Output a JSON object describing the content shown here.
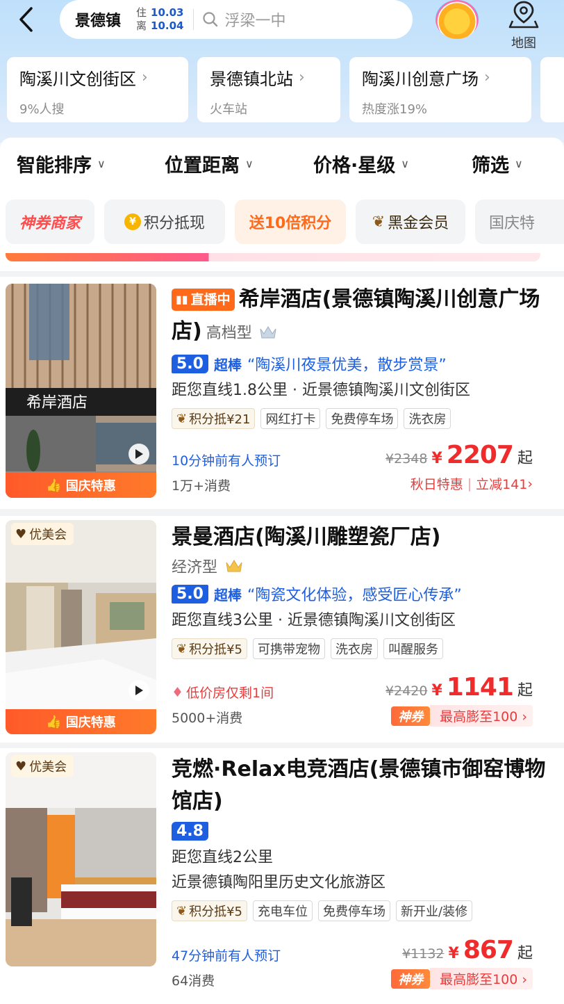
{
  "header": {
    "city": "景德镇",
    "checkin_label": "住",
    "checkin_date": "10.03",
    "checkout_label": "离",
    "checkout_date": "10.04",
    "search_placeholder": "浮梁一中",
    "map_label": "地图"
  },
  "quick_tags": [
    {
      "title": "陶溪川文创街区",
      "sub": "9%人搜"
    },
    {
      "title": "景德镇北站",
      "sub": "火车站"
    },
    {
      "title": "陶溪川创意广场",
      "sub": "热度涨19%"
    }
  ],
  "sort": [
    "智能排序",
    "位置距离",
    "价格·星级",
    "筛选"
  ],
  "chips": [
    "神券商家",
    "积分抵现",
    "送10倍积分",
    "黑金会员",
    "国庆特"
  ],
  "hotels": [
    {
      "live": "直播中",
      "name": "希岸酒店(景德镇陶溪川创意广场店)",
      "grade": "高档型",
      "score": "5.0",
      "score_word": "超棒",
      "quote": "“陶溪川夜景优美，散步赏景”",
      "loc1": "距您直线1.8公里 · 近景德镇陶溪川文创街区",
      "tags": [
        "积分抵¥21",
        "网红打卡",
        "免费停车场",
        "洗衣房"
      ],
      "note": "10分钟前有人预订",
      "sales": "1万+消费",
      "old_price": "¥2348",
      "currency": "¥",
      "price": "2207",
      "qi": "起",
      "deal_left": "秋日特惠",
      "deal_right": "立减141",
      "promo": "国庆特惠",
      "sign_text": "希岸酒店"
    },
    {
      "vip": "优美会",
      "name": "景曼酒店(陶溪川雕塑瓷厂店)",
      "grade": "经济型",
      "score": "5.0",
      "score_word": "超棒",
      "quote": "“陶瓷文化体验，感受匠心传承”",
      "loc1": "距您直线3公里 · 近景德镇陶溪川文创街区",
      "tags": [
        "积分抵¥5",
        "可携带宠物",
        "洗衣房",
        "叫醒服务"
      ],
      "note": "低价房仅剩1间",
      "sales": "5000+消费",
      "old_price": "¥2420",
      "currency": "¥",
      "price": "1141",
      "qi": "起",
      "shen": "神券",
      "deal_right": "最高膨至100",
      "promo": "国庆特惠"
    },
    {
      "vip": "优美会",
      "name": "竞燃·Relax电竞酒店(景德镇市御窑博物馆店)",
      "score": "4.8",
      "loc1": "距您直线2公里",
      "loc2": "近景德镇陶阳里历史文化旅游区",
      "tags": [
        "积分抵¥5",
        "充电车位",
        "免费停车场",
        "新开业/装修"
      ],
      "note": "47分钟前有人预订",
      "sales": "64消费",
      "old_price": "¥1132",
      "currency": "¥",
      "price": "867",
      "qi": "起",
      "shen": "神券",
      "deal_right": "最高膨至100"
    }
  ],
  "colors": {
    "accent_blue": "#1d5fe0",
    "price_red": "#ef2b2b",
    "promo_orange": "#ff6a1a"
  }
}
